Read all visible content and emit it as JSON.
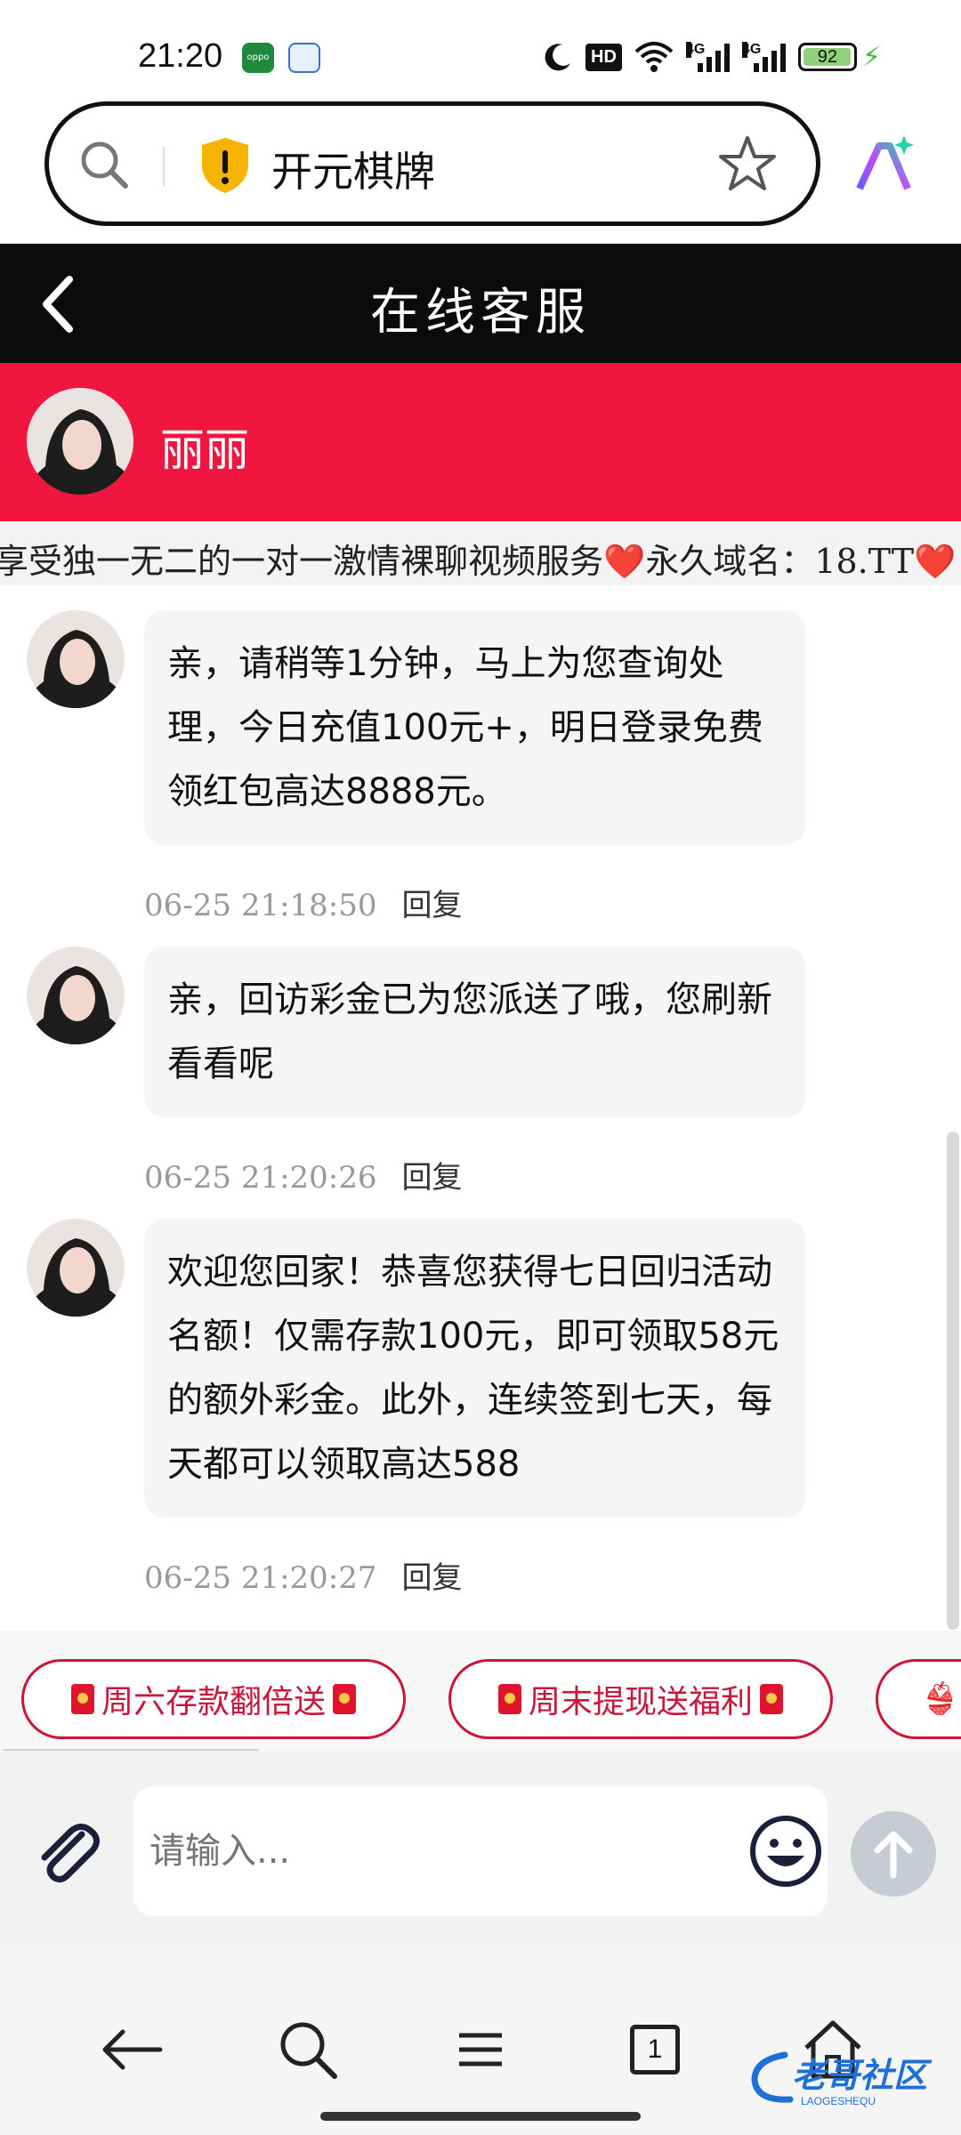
{
  "status_bar": {
    "time": "21:20",
    "hd_label": "HD",
    "network_labels": [
      "4G",
      "4G"
    ],
    "battery": "92"
  },
  "browser": {
    "address_text": "开元棋牌"
  },
  "header": {
    "title": "在线客服"
  },
  "agent": {
    "name": "丽丽"
  },
  "marquee": {
    "text": "享受独一无二的一对一激情裸聊视频服务❤️永久域名：18.TT❤️"
  },
  "messages": [
    {
      "text": "亲，请稍等1分钟，马上为您查询处理，今日充值100元+，明日登录免费领红包高达8888元。",
      "time": "06-25 21:18:50",
      "reply_label": "回复"
    },
    {
      "text": "亲，回访彩金已为您派送了哦，您刷新看看呢",
      "time": "06-25 21:20:26",
      "reply_label": "回复"
    },
    {
      "text": "欢迎您回家！恭喜您获得七日回归活动名额！仅需存款100元，即可领取58元的额外彩金。此外，连续签到七天，每天都可以领取高达588",
      "time": "06-25 21:20:27",
      "reply_label": "回复"
    }
  ],
  "quick_replies": [
    "周六存款翻倍送",
    "周末提现送福利"
  ],
  "input": {
    "placeholder": "请输入..."
  },
  "nav_bar": {
    "tab_count": "1"
  },
  "watermark": {
    "text": "老哥社区",
    "subtext": "LAOGESHEQU"
  },
  "colors": {
    "header_bg": "#0b0b0b",
    "agent_bar_bg": "#f0163f",
    "accent_red": "#c9163a",
    "bubble_bg": "#f5f5f5"
  }
}
